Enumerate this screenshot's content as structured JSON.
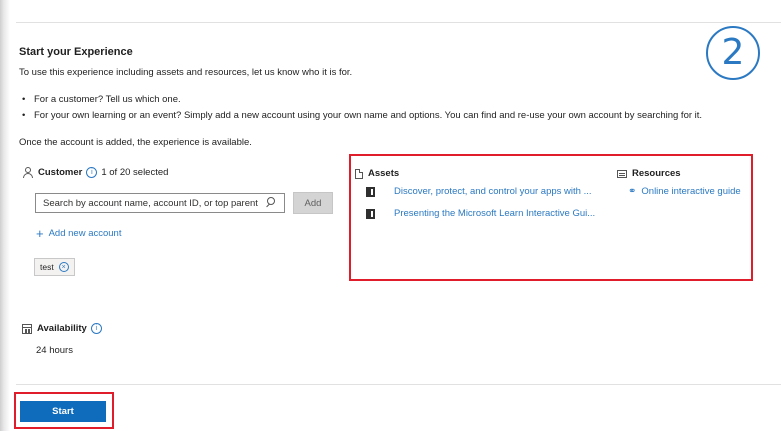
{
  "step": {
    "number": "2"
  },
  "header": {
    "title": "Start your Experience",
    "intro": "To use this experience including assets and resources, let us know who it is for."
  },
  "bullets": [
    "For a customer? Tell us which one.",
    "For your own learning or an event? Simply add a new account using your own name and options. You can find and re-use your own account by searching for it."
  ],
  "note": "Once the account is added, the experience is available.",
  "customer": {
    "label": "Customer",
    "info_glyph": "i",
    "selected_count": "1 of 20 selected",
    "search_placeholder": "Search by account name, account ID, or top parent",
    "add_button": "Add",
    "add_new_label": "Add new account",
    "chips": [
      {
        "label": "test"
      }
    ]
  },
  "assets": {
    "label": "Assets",
    "items": [
      "Discover, protect, and control your apps with ...",
      "Presenting the Microsoft Learn Interactive Gui..."
    ]
  },
  "resources": {
    "label": "Resources",
    "items": [
      "Online interactive guide"
    ]
  },
  "availability": {
    "label": "Availability",
    "value": "24 hours"
  },
  "start_button": "Start",
  "colors": {
    "accent": "#2b79c2",
    "primary_button": "#0f6cbd",
    "highlight_box": "#e01d2b"
  }
}
